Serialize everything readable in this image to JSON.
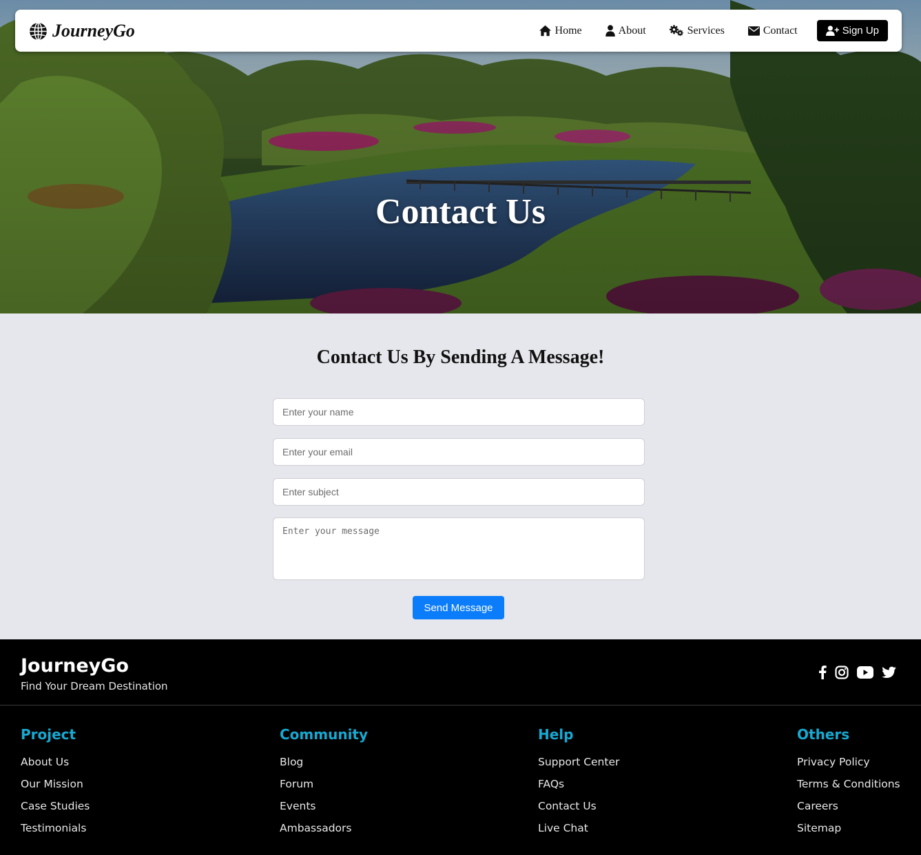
{
  "nav": {
    "brand": "JourneyGo",
    "links": [
      {
        "label": "Home",
        "icon": "home-icon"
      },
      {
        "label": "About",
        "icon": "user-icon"
      },
      {
        "label": "Services",
        "icon": "gears-icon"
      },
      {
        "label": "Contact",
        "icon": "envelope-icon"
      }
    ],
    "signup_label": "Sign Up"
  },
  "hero": {
    "title": "Contact Us"
  },
  "contact": {
    "heading": "Contact Us By Sending A Message!",
    "name_placeholder": "Enter your name",
    "email_placeholder": "Enter your email",
    "subject_placeholder": "Enter subject",
    "message_placeholder": "Enter your message",
    "send_label": "Send Message",
    "accent_color": "#0b7dfa"
  },
  "footer": {
    "brand": "JourneyGo",
    "tagline": "Find Your Dream Destination",
    "socials": [
      "facebook-icon",
      "instagram-icon",
      "youtube-icon",
      "twitter-icon"
    ],
    "heading_color": "#17a9d2",
    "columns": [
      {
        "title": "Project",
        "links": [
          "About Us",
          "Our Mission",
          "Case Studies",
          "Testimonials"
        ]
      },
      {
        "title": "Community",
        "links": [
          "Blog",
          "Forum",
          "Events",
          "Ambassadors"
        ]
      },
      {
        "title": "Help",
        "links": [
          "Support Center",
          "FAQs",
          "Contact Us",
          "Live Chat"
        ]
      },
      {
        "title": "Others",
        "links": [
          "Privacy Policy",
          "Terms & Conditions",
          "Careers",
          "Sitemap"
        ]
      }
    ]
  }
}
